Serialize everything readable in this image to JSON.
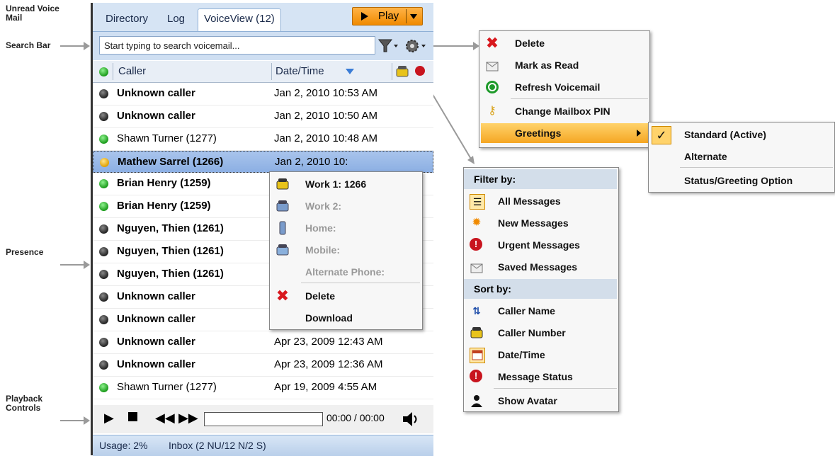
{
  "annotations": {
    "unread": "Unread Voice Mail",
    "search": "Search Bar",
    "presence": "Presence",
    "playback": "Playback Controls"
  },
  "tabs": [
    {
      "label": "Directory"
    },
    {
      "label": "Log"
    },
    {
      "label": "VoiceView (12)"
    }
  ],
  "search": {
    "placeholder": "Start typing to search voicemail..."
  },
  "columns": {
    "caller": "Caller",
    "date": "Date/Time"
  },
  "rows": [
    {
      "caller": "Unknown caller",
      "date": "Jan 2, 2010 10:53 AM",
      "presence": "dark",
      "unread": true
    },
    {
      "caller": "Unknown caller",
      "date": "Jan 2, 2010 10:50 AM",
      "presence": "dark",
      "unread": true
    },
    {
      "caller": "Shawn Turner (1277)",
      "date": "Jan 2, 2010 10:48 AM",
      "presence": "green",
      "unread": false
    },
    {
      "caller": "Mathew Sarrel (1266)",
      "date": "Jan 2, 2010 10:",
      "presence": "yellow",
      "unread": true
    },
    {
      "caller": "Brian Henry (1259)",
      "date": "",
      "presence": "green",
      "unread": true
    },
    {
      "caller": "Brian Henry (1259)",
      "date": "",
      "presence": "green",
      "unread": true
    },
    {
      "caller": "Nguyen, Thien (1261)",
      "date": "",
      "presence": "dark",
      "unread": true
    },
    {
      "caller": "Nguyen, Thien (1261)",
      "date": "",
      "presence": "dark",
      "unread": true
    },
    {
      "caller": "Nguyen, Thien (1261)",
      "date": "",
      "presence": "dark",
      "unread": true
    },
    {
      "caller": "Unknown caller",
      "date": "",
      "presence": "dark",
      "unread": true
    },
    {
      "caller": "Unknown caller",
      "date": "",
      "presence": "dark",
      "unread": true
    },
    {
      "caller": "Unknown caller",
      "date": "Apr 23, 2009 12:43 AM",
      "presence": "dark",
      "unread": true
    },
    {
      "caller": "Unknown caller",
      "date": "Apr 23, 2009 12:36 AM",
      "presence": "dark",
      "unread": true
    },
    {
      "caller": "Shawn Turner (1277)",
      "date": "Apr 19, 2009 4:55 AM",
      "presence": "green",
      "unread": false
    }
  ],
  "play_button": {
    "label": "Play"
  },
  "player": {
    "time": "00:00 / 00:00",
    "progress": 0
  },
  "status": {
    "usage": "Usage: 2%",
    "inbox": "Inbox (2 NU/12 N/2 S)"
  },
  "context_menu": {
    "work1": "Work 1: 1266",
    "work2": "Work 2:",
    "home": "Home:",
    "mobile": "Mobile:",
    "alternate": "Alternate Phone:",
    "delete": "Delete",
    "download": "Download"
  },
  "settings_menu": {
    "delete": "Delete",
    "mark_read": "Mark as Read",
    "refresh": "Refresh Voicemail",
    "change_pin": "Change Mailbox PIN",
    "greetings": "Greetings"
  },
  "greetings_menu": {
    "standard": "Standard (Active)",
    "alternate": "Alternate",
    "status_option": "Status/Greeting Option",
    "check": "✓"
  },
  "filter_menu": {
    "filter_header": "Filter by:",
    "all": "All Messages",
    "new": "New Messages",
    "urgent": "Urgent Messages",
    "saved": "Saved Messages",
    "sort_header": "Sort by:",
    "caller_name": "Caller Name",
    "caller_number": "Caller Number",
    "date_time": "Date/Time",
    "message_status": "Message Status",
    "show_avatar": "Show Avatar"
  }
}
